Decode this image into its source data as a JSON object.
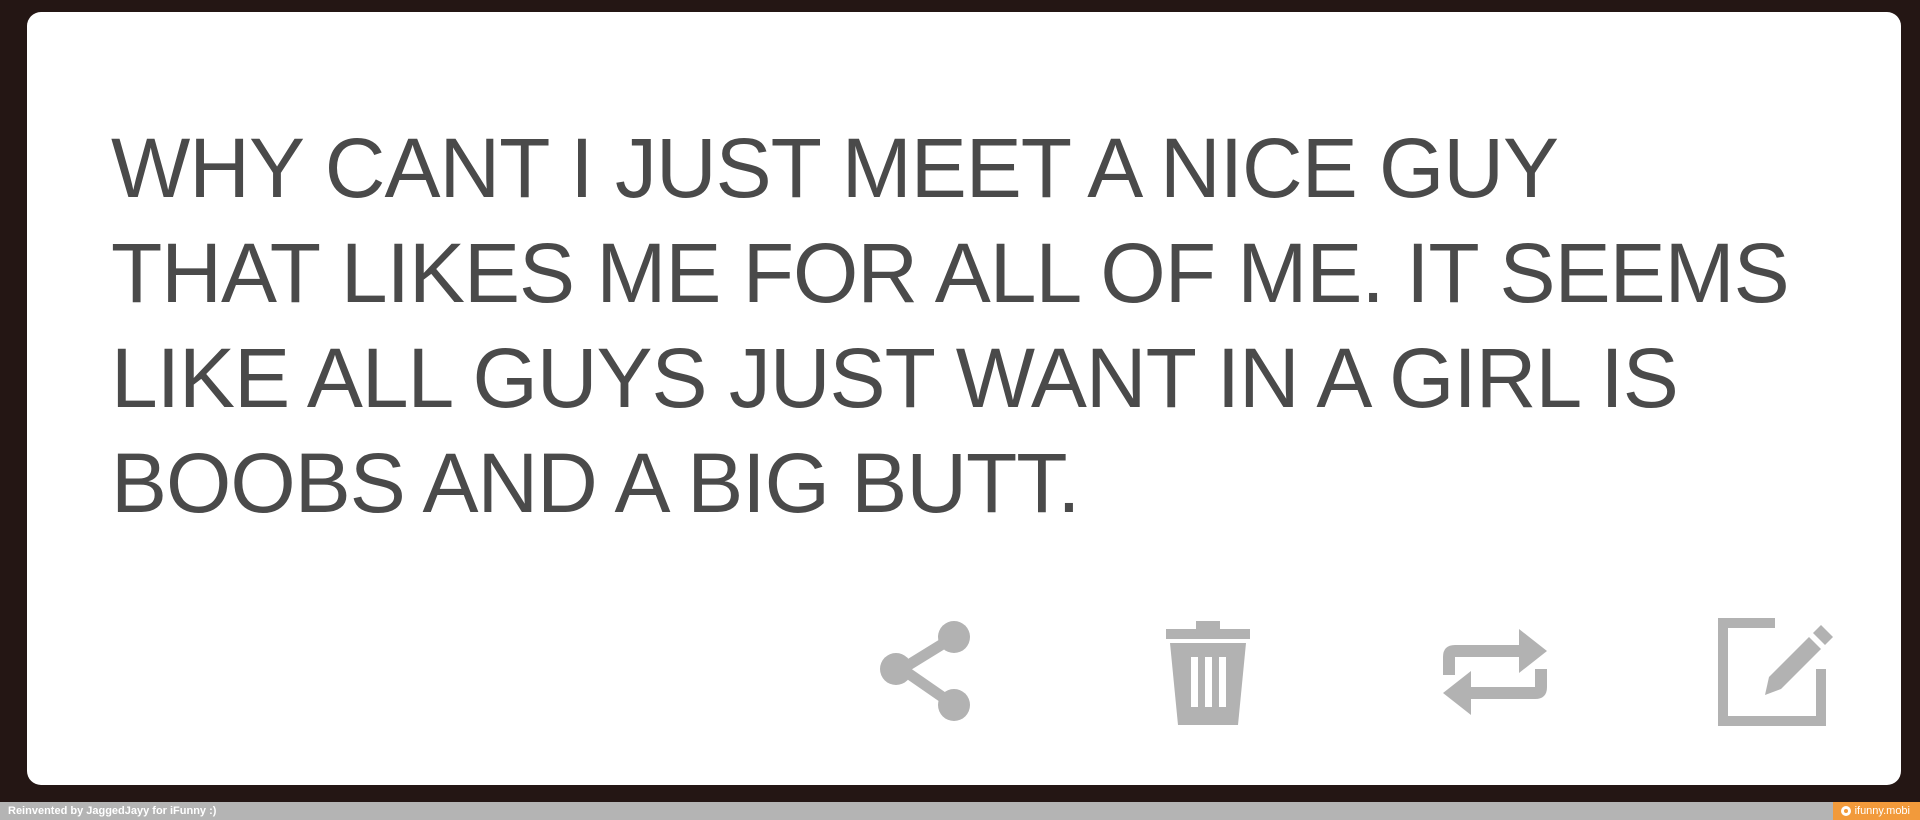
{
  "post": {
    "lines": [
      "WHY CANT I JUST MEET A NICE GUY",
      "THAT LIKES ME FOR ALL OF ME. IT SEEMS",
      "LIKE ALL GUYS JUST WANT IN A GIRL IS",
      "BOOBS AND A BIG BUTT."
    ]
  },
  "actions": [
    {
      "icon": "share-icon"
    },
    {
      "icon": "trash-icon"
    },
    {
      "icon": "repost-icon"
    },
    {
      "icon": "edit-icon"
    }
  ],
  "footer": {
    "credit": "Reinvented by JaggedJayy for iFunny :)",
    "watermark": "ifunny.mobi"
  },
  "colors": {
    "background": "#241614",
    "card": "#ffffff",
    "text": "#4a4a4a",
    "icon": "#b2b2b2",
    "footer_bar": "#b4b4b4",
    "watermark_bg": "#f29a3b"
  }
}
